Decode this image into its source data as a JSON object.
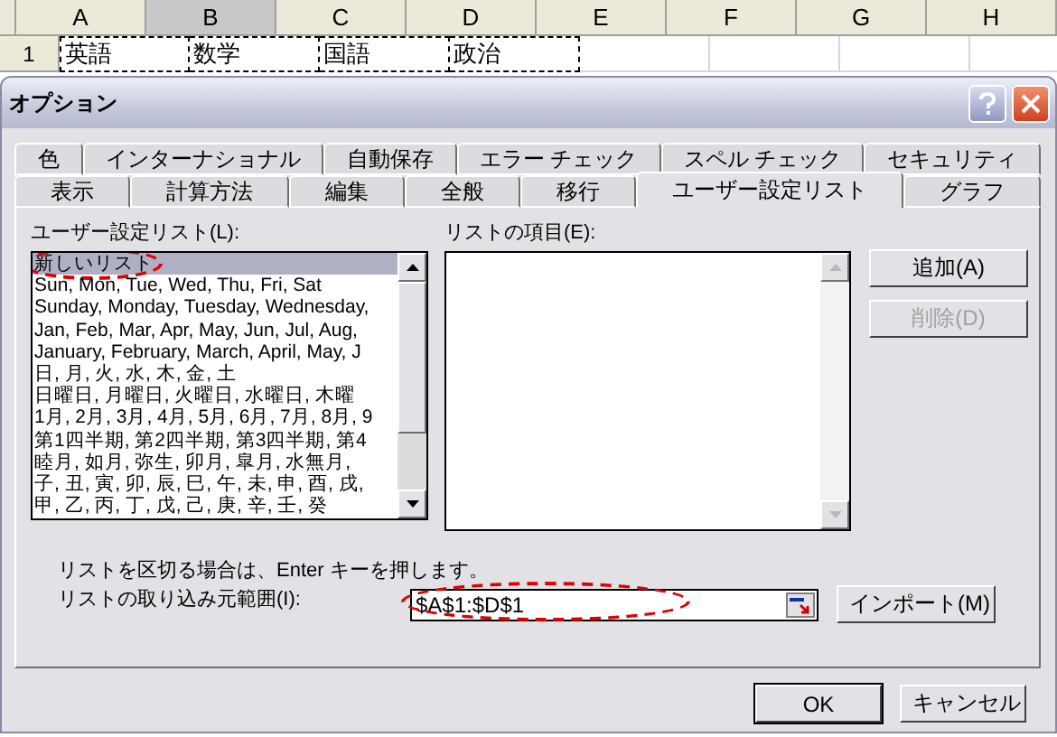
{
  "spreadsheet": {
    "columns": [
      {
        "label": "A",
        "selected": false
      },
      {
        "label": "B",
        "selected": true
      },
      {
        "label": "C",
        "selected": false
      },
      {
        "label": "D",
        "selected": false
      },
      {
        "label": "E",
        "selected": false
      },
      {
        "label": "F",
        "selected": false
      },
      {
        "label": "G",
        "selected": false
      },
      {
        "label": "H",
        "selected": false
      }
    ],
    "row": {
      "number": "1",
      "copy_marquee": true,
      "cells": [
        "英語",
        "数学",
        "国語",
        "政治"
      ]
    }
  },
  "dialog": {
    "title": "オプション",
    "tabs_back": [
      {
        "label": "色",
        "selected": false
      },
      {
        "label": "インターナショナル",
        "selected": false
      },
      {
        "label": "自動保存",
        "selected": false
      },
      {
        "label": "エラー チェック",
        "selected": false
      },
      {
        "label": "スペル チェック",
        "selected": false
      },
      {
        "label": "セキュリティ",
        "selected": false
      }
    ],
    "tabs_front": [
      {
        "label": "表示",
        "selected": false
      },
      {
        "label": "計算方法",
        "selected": false
      },
      {
        "label": "編集",
        "selected": false
      },
      {
        "label": "全般",
        "selected": false
      },
      {
        "label": "移行",
        "selected": false
      },
      {
        "label": "ユーザー設定リスト",
        "selected": true
      },
      {
        "label": "グラフ",
        "selected": false
      }
    ],
    "custom_lists": {
      "label": "ユーザー設定リスト(L):",
      "items": [
        {
          "text": "新しいリスト",
          "selected": true,
          "highlighted": true
        },
        {
          "text": "Sun, Mon, Tue, Wed, Thu, Fri, Sat",
          "selected": false,
          "highlighted": false
        },
        {
          "text": "Sunday, Monday, Tuesday, Wednesday,",
          "selected": false,
          "highlighted": false
        },
        {
          "text": "Jan, Feb, Mar, Apr, May, Jun, Jul, Aug,",
          "selected": false,
          "highlighted": false
        },
        {
          "text": "January, February, March, April, May, J",
          "selected": false,
          "highlighted": false
        },
        {
          "text": "日, 月, 火, 水, 木, 金, 土",
          "selected": false,
          "highlighted": false
        },
        {
          "text": "日曜日, 月曜日, 火曜日, 水曜日, 木曜",
          "selected": false,
          "highlighted": false
        },
        {
          "text": "1月, 2月, 3月, 4月, 5月, 6月, 7月, 8月, 9",
          "selected": false,
          "highlighted": false
        },
        {
          "text": "第1四半期, 第2四半期, 第3四半期, 第4",
          "selected": false,
          "highlighted": false
        },
        {
          "text": "睦月, 如月, 弥生, 卯月, 皐月, 水無月,",
          "selected": false,
          "highlighted": false
        },
        {
          "text": "子, 丑, 寅, 卯, 辰, 巳, 午, 未, 申, 酉, 戌,",
          "selected": false,
          "highlighted": false
        },
        {
          "text": "甲, 乙, 丙, 丁, 戊, 己, 庚, 辛, 壬, 癸",
          "selected": false,
          "highlighted": false
        }
      ]
    },
    "list_entries": {
      "label": "リストの項目(E):"
    },
    "side_buttons": [
      {
        "label": "追加(A)",
        "disabled": false
      },
      {
        "label": "削除(D)",
        "disabled": true
      }
    ],
    "hint": "リストを区切る場合は、Enter キーを押します。",
    "import_range": {
      "label": "リストの取り込み元範囲(I):",
      "value": "$A$1:$D$1",
      "highlighted": true
    },
    "import_button": "インポート(M)",
    "footer_buttons": [
      "OK",
      "キャンセル"
    ]
  }
}
